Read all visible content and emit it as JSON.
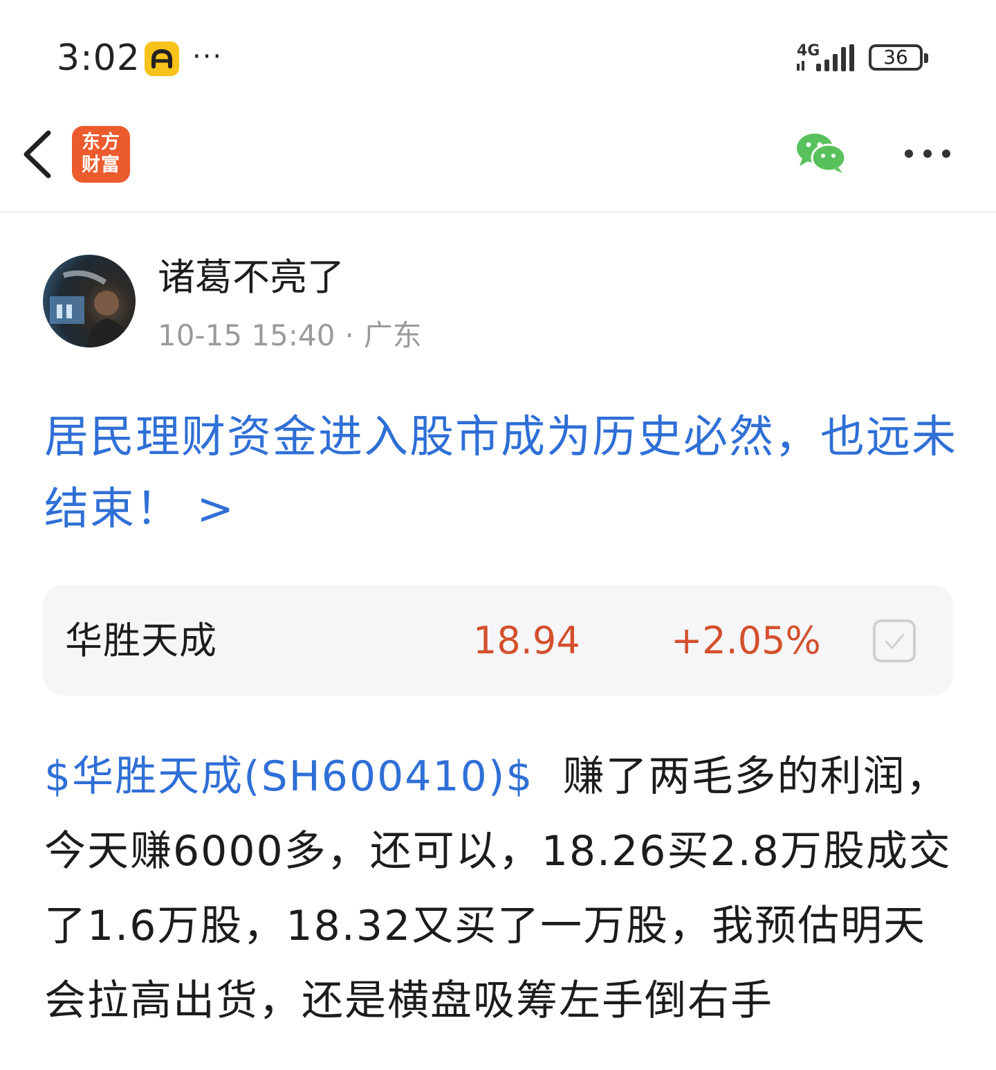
{
  "status_bar": {
    "time": "3:02",
    "more_indicator": "···",
    "network": "4G",
    "battery": "36",
    "icons": [
      "app-notification-icon",
      "signal-icon",
      "battery-icon"
    ]
  },
  "nav": {
    "back_icon": "chevron-left-icon",
    "logo_line1": "东方",
    "logo_line2": "财富",
    "share_icon": "wechat-icon",
    "more_icon": "more-horizontal-icon"
  },
  "author": {
    "name": "诸葛不亮了",
    "date": "10-15 15:40",
    "separator": "·",
    "location": "广东"
  },
  "article_link": {
    "text": "居民理财资金进入股市成为历史必然，也远未结束！ >"
  },
  "stock_card": {
    "name": "华胜天成",
    "price": "18.94",
    "change": "+2.05%",
    "checkbox_icon": "checkbox-icon"
  },
  "post": {
    "stock_tag": "$华胜天成(SH600410)$",
    "content": "  赚了两毛多的利润，今天赚6000多，还可以，18.26买2.8万股成交了1.6万股，18.32又买了一万股，我预估明天会拉高出货，还是横盘吸筹左手倒右手"
  },
  "colors": {
    "link_blue": "#2f6fd6",
    "price_red": "#d4502d",
    "brand_orange": "#ec5b2d",
    "wechat_green": "#58c15b"
  }
}
